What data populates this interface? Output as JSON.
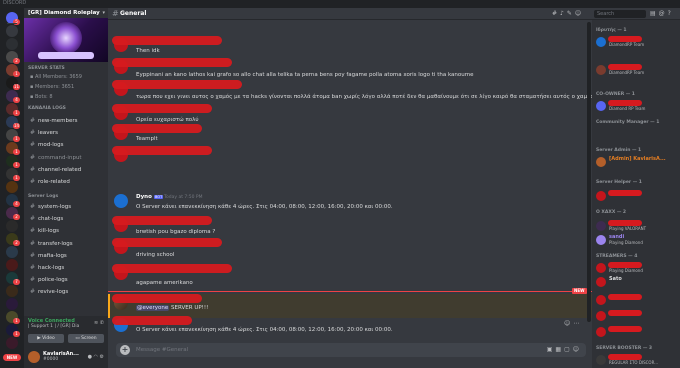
{
  "app": {
    "name": "DISCORD"
  },
  "colors": {
    "accent": "#5865f2",
    "mention_red": "#ed4245",
    "online": "#3ba55d",
    "admin": "#e67e22",
    "redact": "#d61a1f"
  },
  "rail": {
    "badges": [
      "5",
      "",
      "",
      "2",
      "1",
      "11",
      "4",
      "1",
      "14",
      "1",
      "1",
      "1",
      "1",
      "",
      "4",
      "2",
      "",
      "2",
      "",
      "",
      "7",
      "",
      "",
      "1",
      "1",
      ""
    ],
    "new_label": "NEW"
  },
  "guild": {
    "name": "[GR] Diamond Roleplay"
  },
  "sidebar": {
    "server_stats_category": "SERVER STATS",
    "stats": [
      "All Members: 3659",
      "Members: 3651",
      "Bots: 8"
    ],
    "logs_category": "ΚΑΝΑΛΙΑ LOGS",
    "logs_channels": [
      "new-members",
      "leavers",
      "mod-logs",
      "command-input",
      "channel-related",
      "role-related"
    ],
    "server_logs_category": "Server Logs",
    "server_channels": [
      "system-logs",
      "chat-logs",
      "kill-logs",
      "transfer-logs",
      "mafia-logs",
      "hack-logs",
      "police-logs",
      "revive-logs"
    ]
  },
  "voice": {
    "status": "Voice Connected",
    "channel": "| Support 1 | / [GR] Dia",
    "video_label": "Video",
    "screen_label": "Screen"
  },
  "user": {
    "name": "KavlarisAn...",
    "tag": "#0000"
  },
  "channel": {
    "name": "General",
    "search_placeholder": "Search"
  },
  "messages": [
    {
      "text": "Then idk"
    },
    {
      "text": "Eyppinani an kano lathos kai grafo so allo chat alla telika ta perna bens poy fagame polla atoma xoris logo ti tha kanoume"
    },
    {
      "text": "τωρα που εχει γινει αυτος ο χαμός με τα hacks γίνονται πολλά άτομα ban χωρίς λόγο αλλά ποτέ δεν θα μαθαίνουμε ότι σε λίγο καιρό θα σταματήσει αυτός ο χαμός με τα hacks"
    },
    {
      "text": "Ορεία ευχαριστώ πολύ"
    },
    {
      "text": "Teamplt"
    },
    {
      "name": "Dyno",
      "bot": "BOT",
      "time": "Today at 7:50 PM",
      "text": "Ο Server κάνει επανεκκίνηση κάθε 4 ώρες. Στις 04:00, 08:00, 12:00, 16:00, 20:00 και 00:00."
    },
    {
      "text": "brwtish pou bgazo diploma ?"
    },
    {
      "text": "driving school"
    },
    {
      "text": "agapame amerikano"
    },
    {
      "mention": "@everyone",
      "text": " SERVER UP!!!"
    },
    {
      "text": "Ο Server κάνει επανεκκίνηση κάθε 4 ώρες. Στις 04:00, 08:00, 12:00, 16:00, 20:00 και 00:00."
    }
  ],
  "new_marker": "NEW",
  "composer": {
    "placeholder": "Message #General"
  },
  "members": {
    "roles": [
      "Ιδρυτής — 1",
      "CO-OWNER — 1",
      "Community Manager — 1",
      "Server Admin — 1",
      "Server Helper — 1",
      "Ο ΧΑΧΧ — 2",
      "STREAMERS — 4",
      "SERVER BOOSTER — 3"
    ],
    "list": [
      {
        "name": "",
        "activity": "DiamondRP Team",
        "color": "#dcddde"
      },
      {
        "name": "",
        "activity": "DiamondRP Team",
        "color": "#dcddde"
      },
      {
        "name": "",
        "activity": "Diamond RP Team",
        "color": "#dcddde"
      },
      {
        "name": "[Admin] KavlarisA...",
        "activity": "",
        "color": "#e67e22"
      },
      {
        "name": "",
        "activity": "",
        "color": "#dcddde"
      },
      {
        "name": "",
        "activity": "Playing VALORANT",
        "color": "#dcddde"
      },
      {
        "name": "sandi",
        "activity": "Playing Diamond",
        "color": "#9b84ee"
      },
      {
        "name": "",
        "activity": "Playing Diamond",
        "color": "#dcddde"
      },
      {
        "name": "Sato",
        "activity": "",
        "color": "#dcddde"
      },
      {
        "name": "",
        "activity": "",
        "color": "#dcddde"
      },
      {
        "name": "",
        "activity": "",
        "color": "#dcddde"
      },
      {
        "name": "",
        "activity": "",
        "color": "#dcddde"
      },
      {
        "name": "",
        "activity": "REGULAR ΣΤΟ DISCOR...",
        "color": "#dcddde"
      }
    ]
  }
}
